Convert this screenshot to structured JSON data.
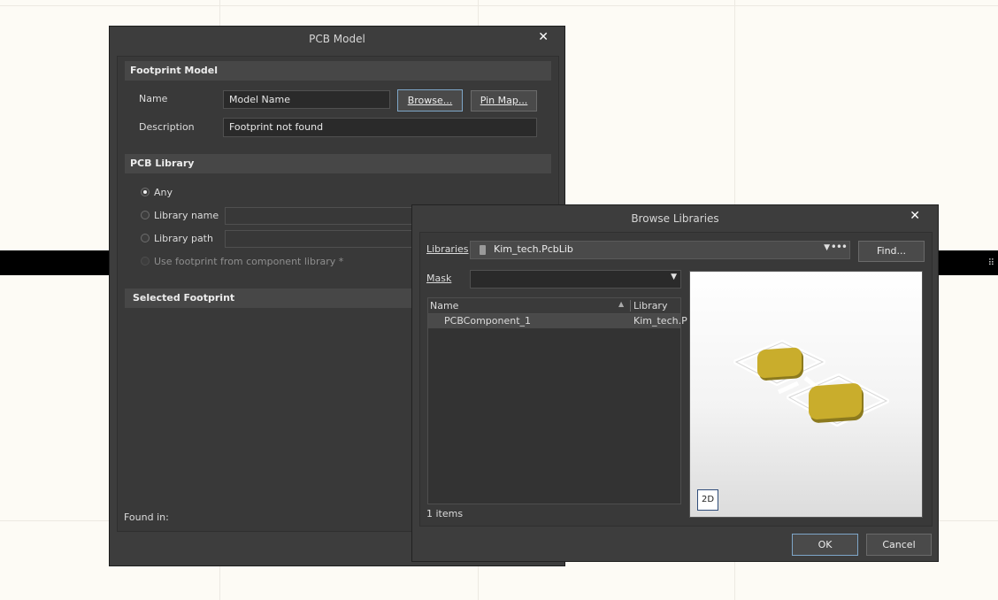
{
  "pcb_model": {
    "title": "PCB Model",
    "footprint_model": {
      "heading": "Footprint Model",
      "name_label": "Name",
      "name_value": "Model Name",
      "browse_label": "Browse...",
      "pin_map_label": "Pin Map...",
      "description_label": "Description",
      "description_value": "Footprint not found"
    },
    "pcb_library": {
      "heading": "PCB Library",
      "any_label": "Any",
      "library_name_label": "Library name",
      "library_path_label": "Library path",
      "use_footprint_label": "Use footprint from component library *"
    },
    "selected_footprint": {
      "heading": "Selected Footprint"
    },
    "found_in_label": "Found in:"
  },
  "browse_libraries": {
    "title": "Browse Libraries",
    "libraries_label": "Libraries",
    "libraries_value": "Kim_tech.PcbLib",
    "find_label": "Find...",
    "mask_label": "Mask",
    "mask_value": "",
    "columns": {
      "name": "Name",
      "library": "Library"
    },
    "rows": [
      {
        "name": "PCBComponent_1",
        "library": "Kim_tech.P"
      }
    ],
    "count_text": "1 items",
    "view_mode_label": "2D",
    "ok_label": "OK",
    "cancel_label": "Cancel"
  },
  "colors": {
    "dialog_bg": "#3d3d3d",
    "section_bg": "#474747",
    "pad_gold": "#c9ad2c",
    "preview_bg": "#f2f2f2"
  }
}
